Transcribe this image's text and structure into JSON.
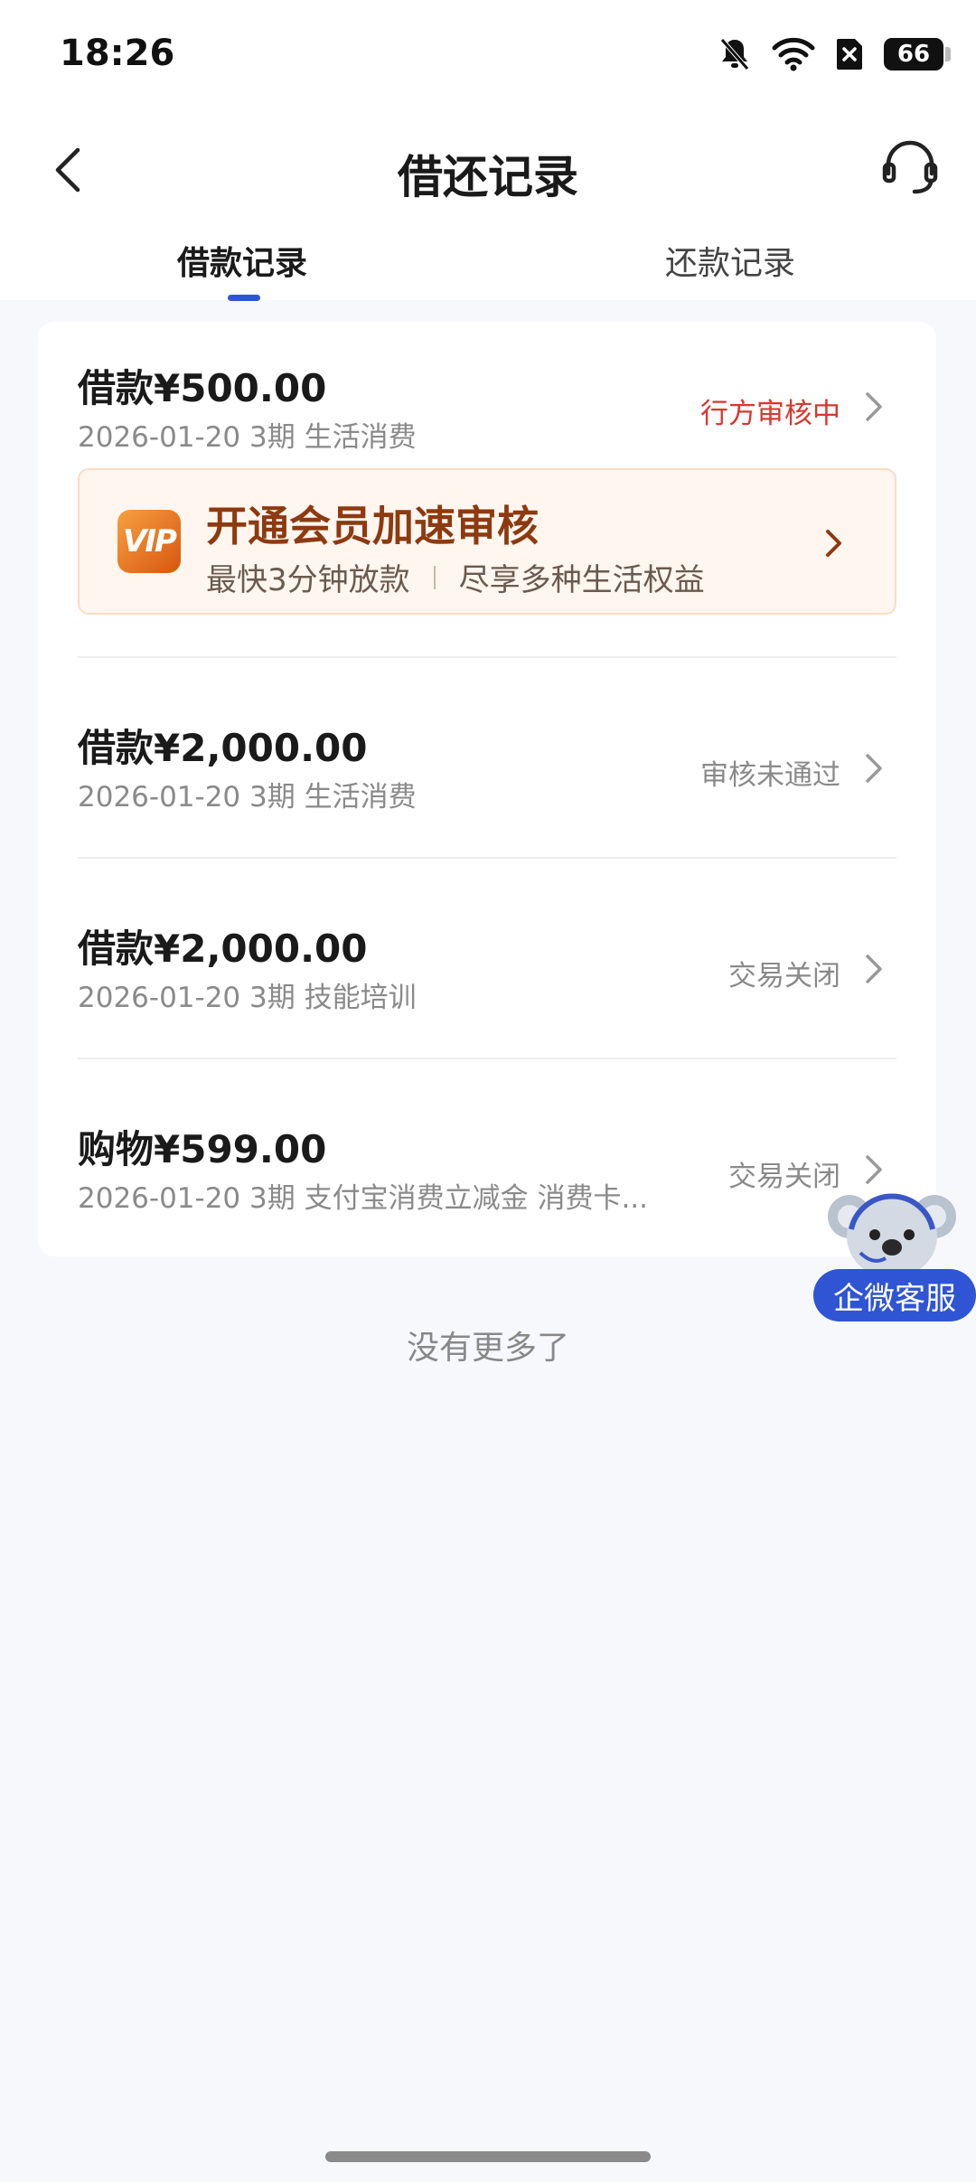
{
  "status_bar": {
    "time": "18:26",
    "battery": "66"
  },
  "header": {
    "title": "借还记录"
  },
  "tabs": [
    {
      "label": "借款记录",
      "active": true
    },
    {
      "label": "还款记录",
      "active": false
    }
  ],
  "records": [
    {
      "amount": "借款¥500.00",
      "meta": "2026-01-20 3期  生活消费",
      "status": "行方审核中",
      "status_color": "#d9362f"
    },
    {
      "amount": "借款¥2,000.00",
      "meta": "2026-01-20 3期  生活消费",
      "status": "审核未通过"
    },
    {
      "amount": "借款¥2,000.00",
      "meta": "2026-01-20 3期  技能培训",
      "status": "交易关闭"
    },
    {
      "amount": "购物¥599.00",
      "meta": "2026-01-20 3期  支付宝消费立减金 消费卡...",
      "status": "交易关闭"
    }
  ],
  "vip_banner": {
    "badge": "VIP",
    "title": "开通会员加速审核",
    "sub_left": "最快3分钟放款",
    "sub_right": "尽享多种生活权益"
  },
  "footer": {
    "no_more": "没有更多了"
  },
  "float_service": {
    "label": "企微客服"
  },
  "colors": {
    "accent": "#2f55d4",
    "status_red": "#d9362f",
    "vip_title": "#8d3a10"
  }
}
